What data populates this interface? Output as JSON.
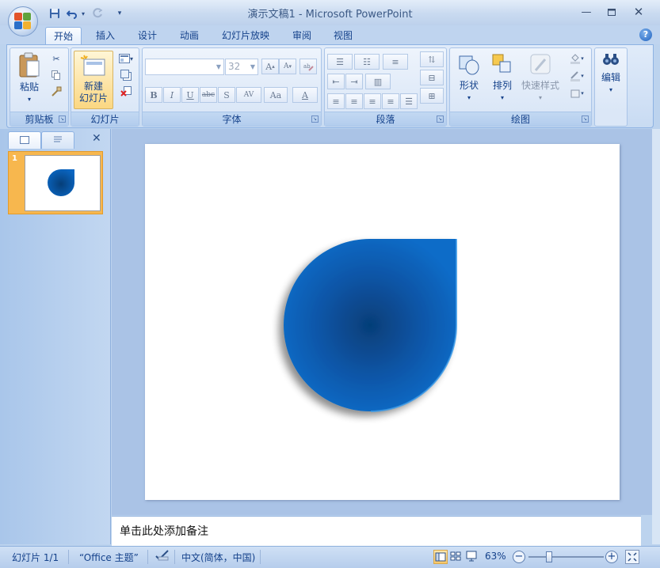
{
  "titlebar": {
    "title": "演示文稿1 - Microsoft PowerPoint",
    "qat": {
      "save_icon": "save-icon",
      "undo_icon": "undo-icon",
      "redo_icon": "redo-icon",
      "customize_icon": "chevron-down-icon"
    },
    "window_buttons": [
      "minimize-icon",
      "maximize-icon",
      "close-icon"
    ]
  },
  "tabs": [
    "开始",
    "插入",
    "设计",
    "动画",
    "幻灯片放映",
    "审阅",
    "视图"
  ],
  "active_tab": "开始",
  "ribbon": {
    "clipboard": {
      "label": "剪贴板",
      "paste": "粘贴"
    },
    "slides": {
      "label": "幻灯片",
      "new_slide_line1": "新建",
      "new_slide_line2": "幻灯片"
    },
    "font": {
      "label": "字体",
      "font_name": "",
      "font_size": "32",
      "buttons": [
        "B",
        "I",
        "U",
        "abc",
        "S",
        "AV",
        "Aa",
        "A"
      ]
    },
    "paragraph": {
      "label": "段落"
    },
    "drawing": {
      "label": "绘图",
      "shapes": "形状",
      "arrange": "排列",
      "quick_styles": "快速样式"
    },
    "editing": {
      "label": "编辑"
    }
  },
  "left_pane": {
    "slide_number": "1"
  },
  "notes": {
    "placeholder": "单击此处添加备注"
  },
  "statusbar": {
    "slide_info": "幻灯片 1/1",
    "theme": "“Office 主题”",
    "language": "中文(简体，中国)",
    "zoom": "63%"
  },
  "slide": {
    "shape": "teardrop",
    "shape_color": "#0a66c2",
    "shape_center_color": "#063e78"
  },
  "colors": {
    "accent": "#15428b",
    "thumb_selected": "#f7b74e"
  }
}
